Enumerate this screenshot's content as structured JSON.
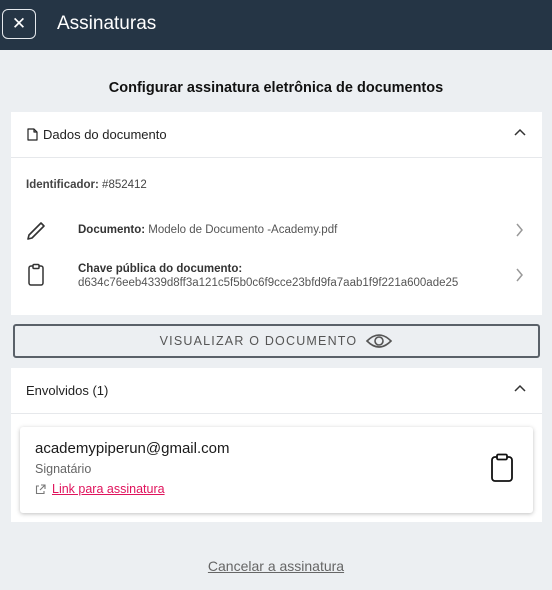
{
  "header": {
    "title": "Assinaturas",
    "close_icon": "close-icon"
  },
  "page": {
    "heading": "Configurar assinatura eletrônica de documentos"
  },
  "document_section": {
    "title": "Dados do documento",
    "identifier_label": "Identificador:",
    "identifier_value": "#852412",
    "document_label": "Documento:",
    "document_value": "Modelo de Documento -Academy.pdf",
    "public_key_label": "Chave pública do documento:",
    "public_key_value": "d634c76eeb4339d8ff3a121c5f5b0c6f9cce23bfd9fa7aab1f9f221a600ade25"
  },
  "view_button": {
    "label": "VISUALIZAR O DOCUMENTO"
  },
  "involved_section": {
    "title": "Envolvidos (1)",
    "signers": [
      {
        "email": "academypiperun@gmail.com",
        "role": "Signatário",
        "link_label": "Link para assinatura"
      }
    ]
  },
  "footer": {
    "cancel_label": "Cancelar a assinatura"
  },
  "colors": {
    "topbar": "#253545",
    "link": "#e0135c",
    "background": "#eceff2"
  }
}
